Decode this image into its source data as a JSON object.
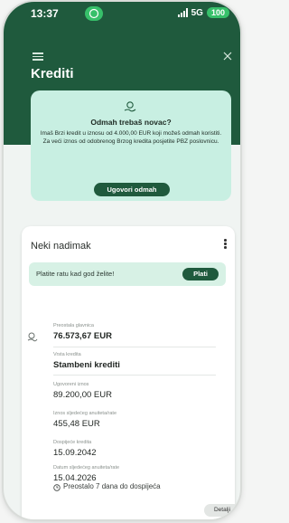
{
  "status_bar": {
    "time": "13:37",
    "network": "5G",
    "battery": "100"
  },
  "header": {
    "title": "Krediti"
  },
  "promo": {
    "title": "Odmah trebaš novac?",
    "text": "Imaš Brzi kredit u iznosu od 4.000,00 EUR koji možeš odmah koristiti. Za veći iznos od odobrenog Brzog kredita posjetite PBZ poslovnicu.",
    "button_label": "Ugovori odmah"
  },
  "loan_card": {
    "title": "Neki nadimak",
    "pay_prompt": "Platite ratu kad god želite!",
    "pay_button": "Plati",
    "fields": [
      {
        "label": "Preostala glavnica",
        "value": "76.573,67 EUR"
      },
      {
        "label": "Vrsta kredita",
        "value": "Stambeni krediti"
      },
      {
        "label": "Ugovoreni iznos",
        "value": "89.200,00 EUR"
      },
      {
        "label": "Iznos sljedećeg anuiteta/rate",
        "value": "455,48 EUR"
      },
      {
        "label": "Dospijeće kredita",
        "value": "15.09.2042"
      },
      {
        "label": "Datum sljedećeg anuiteta/rate",
        "value": "15.04.2026"
      }
    ],
    "countdown": "Preostalo 7 dana do dospijeća",
    "details_button": "Detalji"
  },
  "colors": {
    "brand_green": "#1f5a3d",
    "promo_bg": "#c8efe2",
    "pay_bar_bg": "#d7f1e5"
  }
}
